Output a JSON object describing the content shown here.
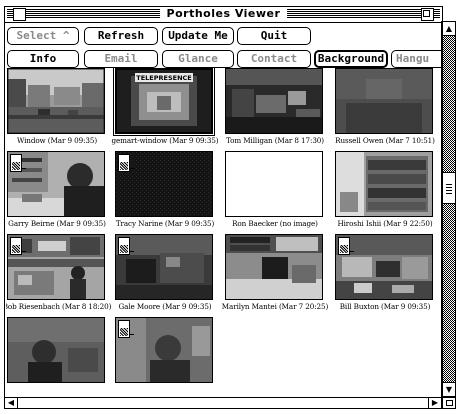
{
  "window": {
    "title": "Portholes Viewer"
  },
  "toolbar_row1": [
    {
      "label": "Select ^",
      "dim": true
    },
    {
      "label": "Refresh",
      "dim": false
    },
    {
      "label": "Update Me",
      "dim": false
    },
    {
      "label": "Quit",
      "dim": false
    }
  ],
  "toolbar_row2": [
    {
      "label": "Info",
      "dim": false
    },
    {
      "label": "Email",
      "dim": true
    },
    {
      "label": "Glance",
      "dim": true
    },
    {
      "label": "Contact",
      "dim": true
    },
    {
      "label": "Background",
      "dim": false,
      "thick": true
    },
    {
      "label": "Hangu",
      "dim": true
    }
  ],
  "portholes": [
    {
      "caption": "Window (Mar 9 09:35)",
      "scene": "street",
      "badge": false,
      "selected": false
    },
    {
      "caption": "gemart-window (Mar 9 09:35)",
      "scene": "tv",
      "badge": false,
      "selected": true,
      "sign_text": "TELEPRESENCE"
    },
    {
      "caption": "Tom Milligan (Mar 8 17:30)",
      "scene": "office-dark",
      "badge": false,
      "selected": false
    },
    {
      "caption": "Russell Owen (Mar 7 10:51)",
      "scene": "dark-gray",
      "badge": false,
      "selected": false
    },
    {
      "caption": "Garry Beirne (Mar 9 09:35)",
      "scene": "person-desk",
      "badge": true,
      "selected": false
    },
    {
      "caption": "Tracy Narine (Mar 9 09:35)",
      "scene": "black",
      "badge": true,
      "selected": false
    },
    {
      "caption": "Ron Baecker (no image)",
      "scene": "blank",
      "badge": false,
      "selected": false
    },
    {
      "caption": "Hiroshi Ishii (Mar 9 22:50)",
      "scene": "bookshelf",
      "badge": false,
      "selected": false
    },
    {
      "caption": "Bob Riesenbach (Mar 8 18:20)",
      "scene": "lab",
      "badge": true,
      "selected": false
    },
    {
      "caption": "Gale Moore (Mar 9 09:35)",
      "scene": "chair-dark",
      "badge": true,
      "selected": false
    },
    {
      "caption": "Marilyn Mantei (Mar 7 20:25)",
      "scene": "office-chair",
      "badge": false,
      "selected": false
    },
    {
      "caption": "Bill Buxton (Mar 9 09:35)",
      "scene": "cluttered",
      "badge": true,
      "selected": false
    },
    {
      "caption": "",
      "scene": "person-dim",
      "badge": false,
      "selected": false
    },
    {
      "caption": "",
      "scene": "person-gray",
      "badge": true,
      "selected": false
    }
  ],
  "icons": {
    "close": "close-box-icon",
    "zoom": "zoom-box-icon",
    "scroll_up": "arrow-up-icon",
    "scroll_down": "arrow-down-icon",
    "scroll_left": "arrow-left-icon",
    "scroll_right": "arrow-right-icon",
    "grow": "grow-box-icon",
    "status": "document-status-icon"
  }
}
